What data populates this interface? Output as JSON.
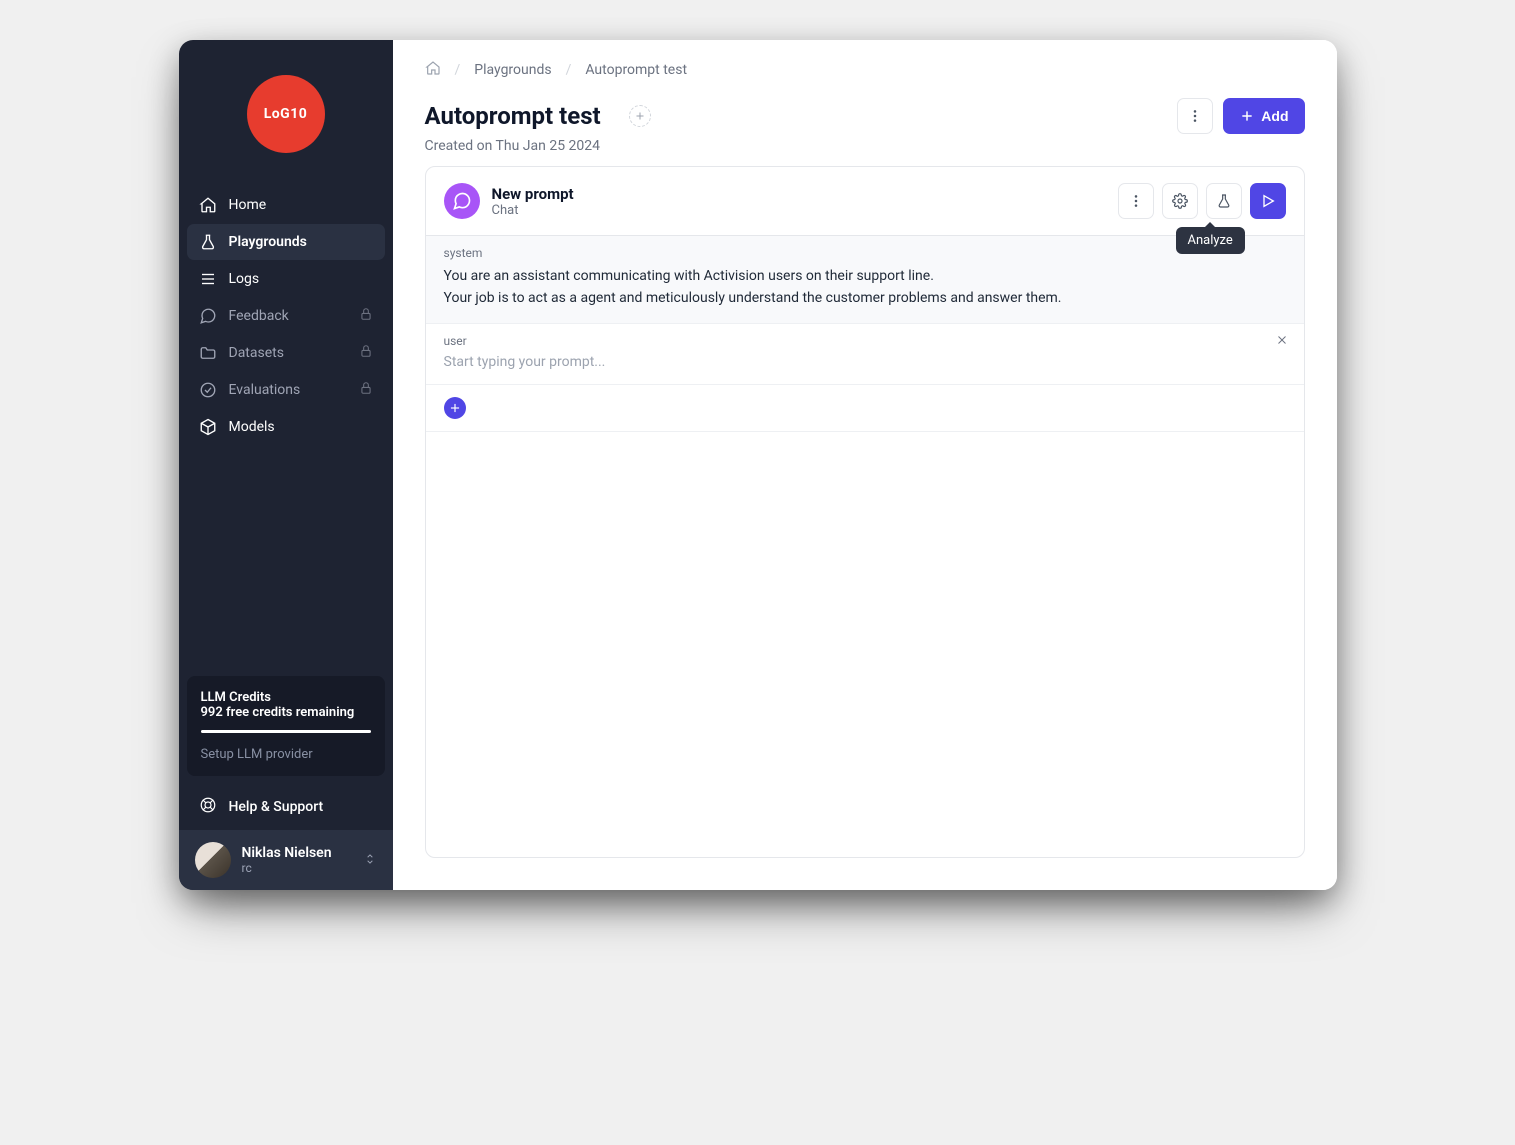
{
  "brand": {
    "logo_text": "LoG10"
  },
  "sidebar": {
    "items": [
      {
        "label": "Home",
        "icon": "home-icon",
        "locked": false,
        "active": false,
        "bright": true
      },
      {
        "label": "Playgrounds",
        "icon": "flask-icon",
        "locked": false,
        "active": true,
        "bright": true
      },
      {
        "label": "Logs",
        "icon": "list-icon",
        "locked": false,
        "active": false,
        "bright": true
      },
      {
        "label": "Feedback",
        "icon": "chat-icon",
        "locked": true,
        "active": false,
        "bright": false
      },
      {
        "label": "Datasets",
        "icon": "folder-icon",
        "locked": true,
        "active": false,
        "bright": false
      },
      {
        "label": "Evaluations",
        "icon": "check-circle-icon",
        "locked": true,
        "active": false,
        "bright": false
      },
      {
        "label": "Models",
        "icon": "cube-icon",
        "locked": false,
        "active": false,
        "bright": true
      }
    ],
    "credits": {
      "title": "LLM Credits",
      "remaining": "992 free credits remaining",
      "setup_link": "Setup LLM provider"
    },
    "help_label": "Help & Support",
    "user": {
      "name": "Niklas Nielsen",
      "org": "rc"
    }
  },
  "breadcrumb": {
    "items": [
      "Playgrounds",
      "Autoprompt test"
    ]
  },
  "page": {
    "title": "Autoprompt test",
    "created_on": "Created on Thu Jan 25 2024",
    "add_button": "Add"
  },
  "prompt_card": {
    "title": "New prompt",
    "subtitle": "Chat",
    "tooltip": "Analyze",
    "messages": {
      "system": {
        "role": "system",
        "line1": "You are an assistant communicating with Activision users on their support line.",
        "line2": "Your job is to act as a agent and meticulously understand the customer problems and answer them."
      },
      "user": {
        "role": "user",
        "placeholder": "Start typing your prompt..."
      }
    }
  }
}
